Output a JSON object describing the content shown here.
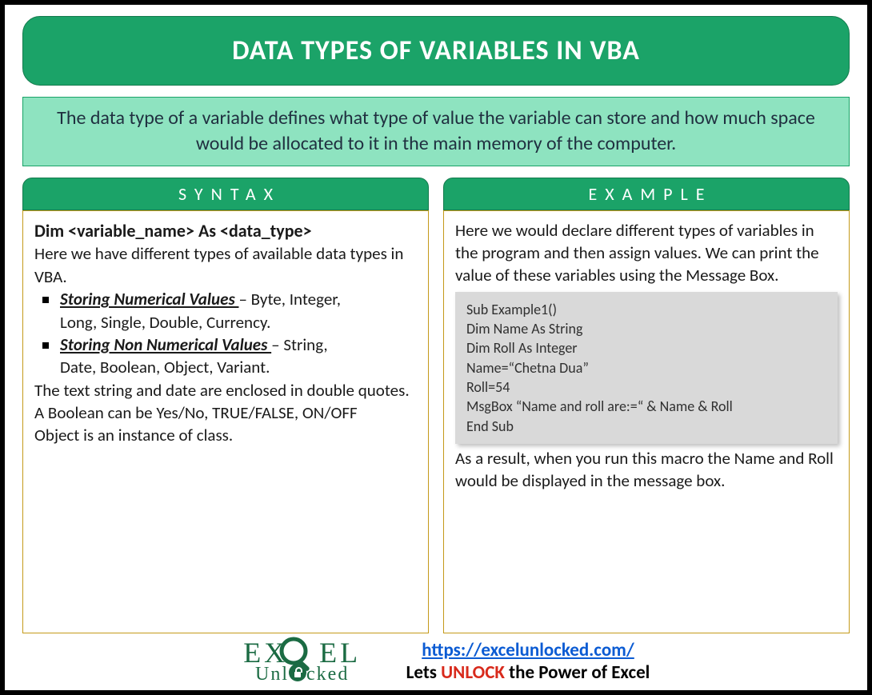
{
  "title": "DATA TYPES OF VARIABLES IN VBA",
  "intro": "The data type of a variable defines what type of value the variable can store and how much space would be allocated to it in the main memory of the computer.",
  "syntax": {
    "header": "SYNTAX",
    "declaration": "Dim <variable_name> As <data_type>",
    "lead": "Here we have different types of available data types in VBA.",
    "bullets": [
      {
        "label": "Storing Numerical Values ",
        "rest": "– Byte, Integer,",
        "cont": "Long, Single, Double, Currency."
      },
      {
        "label": "Storing Non Numerical Values ",
        "rest": "– String,",
        "cont": "Date, Boolean, Object, Variant."
      }
    ],
    "notes": [
      "The text string and date are enclosed in double quotes.",
      "A Boolean can be Yes/No, TRUE/FALSE, ON/OFF",
      "Object is an instance of class."
    ]
  },
  "example": {
    "header": "EXAMPLE",
    "intro": "Here we would declare different types of variables in the program and then assign values. We can print the value of these variables using the Message Box.",
    "code": "Sub Example1()\nDim Name As String\nDim Roll As Integer\nName=“Chetna Dua”\nRoll=54\nMsgBox “Name and roll are:=“ & Name & Roll\nEnd Sub",
    "result": "As a result, when you run this macro the Name and Roll would be displayed in the message box."
  },
  "footer": {
    "logo_top": "EX   EL",
    "logo_bottom_pre": "Unl",
    "logo_bottom_post": "cked",
    "url": "https://excelunlocked.com/",
    "tagline_pre": "Lets ",
    "unlock": "UNLOCK",
    "tagline_post": " the Power of Excel"
  }
}
